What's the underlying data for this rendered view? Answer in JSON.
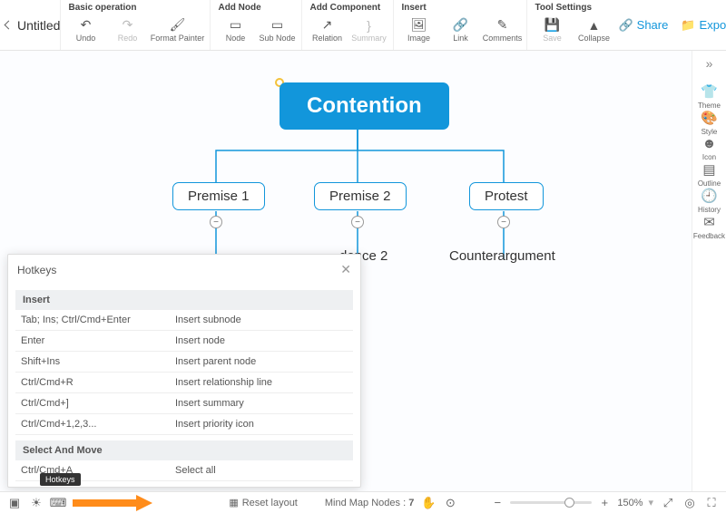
{
  "title": "Untitled",
  "toolbar": {
    "g1": {
      "hdr": "Basic operation",
      "btns": [
        {
          "n": "undo",
          "l": "Undo",
          "i": "↶"
        },
        {
          "n": "redo",
          "l": "Redo",
          "i": "↷",
          "dis": true
        },
        {
          "n": "format-painter",
          "l": "Format Painter",
          "i": "🖌",
          "w": true
        }
      ]
    },
    "g2": {
      "hdr": "Add Node",
      "btns": [
        {
          "n": "node",
          "l": "Node",
          "i": "▭"
        },
        {
          "n": "sub-node",
          "l": "Sub Node",
          "i": "▭"
        }
      ]
    },
    "g3": {
      "hdr": "Add Component",
      "btns": [
        {
          "n": "relation",
          "l": "Relation",
          "i": "↗"
        },
        {
          "n": "summary",
          "l": "Summary",
          "i": "}",
          "dis": true
        }
      ]
    },
    "g4": {
      "hdr": "Insert",
      "btns": [
        {
          "n": "image",
          "l": "Image",
          "i": "🖼"
        },
        {
          "n": "link",
          "l": "Link",
          "i": "🔗"
        },
        {
          "n": "comments",
          "l": "Comments",
          "i": "✎"
        }
      ]
    },
    "g5": {
      "hdr": "Tool Settings",
      "btns": [
        {
          "n": "save",
          "l": "Save",
          "i": "💾",
          "dis": true
        },
        {
          "n": "collapse",
          "l": "Collapse",
          "i": "▲"
        }
      ]
    }
  },
  "share": "Share",
  "export": "Export",
  "mindmap": {
    "root": "Contention",
    "children": [
      {
        "l": "Premise 1"
      },
      {
        "l": "Premise 2"
      },
      {
        "l": "Protest"
      }
    ],
    "gchild": [
      {
        "l": "dence 2"
      },
      {
        "l": "Counterargument"
      }
    ]
  },
  "rside": [
    {
      "n": "theme",
      "l": "Theme",
      "i": "👕"
    },
    {
      "n": "style",
      "l": "Style",
      "i": "🎨"
    },
    {
      "n": "icon",
      "l": "Icon",
      "i": "☻"
    },
    {
      "n": "outline",
      "l": "Outline",
      "i": "▤"
    },
    {
      "n": "history",
      "l": "History",
      "i": "🕘"
    },
    {
      "n": "feedback",
      "l": "Feedback",
      "i": "✉"
    }
  ],
  "hotkeys": {
    "title": "Hotkeys",
    "sections": [
      {
        "hdr": "Insert",
        "rows": [
          {
            "k": "Tab; Ins; Ctrl/Cmd+Enter",
            "d": "Insert subnode"
          },
          {
            "k": "Enter",
            "d": "Insert node"
          },
          {
            "k": "Shift+Ins",
            "d": "Insert parent node"
          },
          {
            "k": "Ctrl/Cmd+R",
            "d": "Insert relationship line"
          },
          {
            "k": "Ctrl/Cmd+]",
            "d": "Insert summary"
          },
          {
            "k": "Ctrl/Cmd+1,2,3...",
            "d": "Insert priority icon"
          }
        ]
      },
      {
        "hdr": "Select And Move",
        "rows": [
          {
            "k": "Ctrl/Cmd+A",
            "d": "Select all"
          }
        ]
      }
    ]
  },
  "tooltip": "Hotkeys",
  "status": {
    "reset": "Reset layout",
    "nodes_lbl": "Mind Map Nodes :",
    "nodes": "7",
    "zoom": "150%"
  }
}
